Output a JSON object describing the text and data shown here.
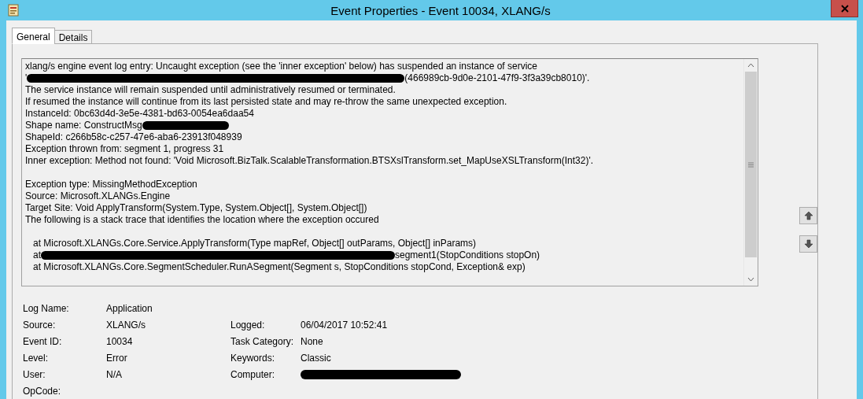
{
  "window": {
    "title": "Event Properties - Event 10034, XLANG/s"
  },
  "tabs": [
    {
      "label": "General",
      "selected": true
    },
    {
      "label": "Details",
      "selected": false
    }
  ],
  "message": {
    "lines": [
      {
        "parts": [
          {
            "kind": "text",
            "text": "xlang/s engine event log entry: Uncaught exception (see the 'inner exception' below) has suspended an instance of service"
          }
        ]
      },
      {
        "parts": [
          {
            "kind": "text",
            "text": "'"
          },
          {
            "kind": "redacted"
          },
          {
            "kind": "text",
            "text": "(466989cb-9d0e-2101-47f9-3f3a39cb8010)'."
          }
        ]
      },
      {
        "parts": [
          {
            "kind": "text",
            "text": "The service instance will remain suspended until administratively resumed or terminated."
          }
        ]
      },
      {
        "parts": [
          {
            "kind": "text",
            "text": "If resumed the instance will continue from its last persisted state and may re-throw the same unexpected exception."
          }
        ]
      },
      {
        "parts": [
          {
            "kind": "text",
            "text": "InstanceId: 0bc63d4d-3e5e-4381-bd63-0054ea6daa54"
          }
        ]
      },
      {
        "parts": [
          {
            "kind": "text",
            "text": "Shape name: ConstructMsg"
          },
          {
            "kind": "redacted"
          }
        ]
      },
      {
        "parts": [
          {
            "kind": "text",
            "text": "ShapeId: c266b58c-c257-47e6-aba6-23913f048939"
          }
        ]
      },
      {
        "parts": [
          {
            "kind": "text",
            "text": "Exception thrown from: segment 1, progress 31"
          }
        ]
      },
      {
        "parts": [
          {
            "kind": "text",
            "text": "Inner exception: Method not found: 'Void Microsoft.BizTalk.ScalableTransformation.BTSXslTransform.set_MapUseXSLTransform(Int32)'."
          }
        ]
      },
      {
        "gap_before": true,
        "parts": [
          {
            "kind": "text",
            "text": "Exception type: MissingMethodException"
          }
        ]
      },
      {
        "parts": [
          {
            "kind": "text",
            "text": "Source: Microsoft.XLANGs.Engine"
          }
        ]
      },
      {
        "parts": [
          {
            "kind": "text",
            "text": "Target Site: Void ApplyTransform(System.Type, System.Object[], System.Object[])"
          }
        ]
      },
      {
        "parts": [
          {
            "kind": "text",
            "text": "The following is a stack trace that identifies the location where the exception occured"
          }
        ]
      },
      {
        "gap_before": true,
        "parts": [
          {
            "kind": "text",
            "text": "   at Microsoft.XLANGs.Core.Service.ApplyTransform(Type mapRef, Object[] outParams, Object[] inParams)"
          }
        ]
      },
      {
        "parts": [
          {
            "kind": "text",
            "text": "   at"
          },
          {
            "kind": "redacted"
          },
          {
            "kind": "text",
            "text": "segment1(StopConditions stopOn)"
          }
        ]
      },
      {
        "parts": [
          {
            "kind": "text",
            "text": "   at Microsoft.XLANGs.Core.SegmentScheduler.RunASegment(Segment s, StopConditions stopCond, Exception& exp)"
          }
        ]
      }
    ]
  },
  "details": [
    {
      "left": {
        "label": "Log Name:",
        "value": "Application"
      }
    },
    {
      "left": {
        "label": "Source:",
        "value": "XLANG/s"
      },
      "right": {
        "label": "Logged:",
        "value": "06/04/2017 10:52:41"
      }
    },
    {
      "left": {
        "label": "Event ID:",
        "value": "10034"
      },
      "right": {
        "label": "Task Category:",
        "value": "None"
      }
    },
    {
      "left": {
        "label": "Level:",
        "value": "Error"
      },
      "right": {
        "label": "Keywords:",
        "value": "Classic"
      }
    },
    {
      "left": {
        "label": "User:",
        "value": "N/A"
      },
      "right": {
        "label": "Computer:",
        "redacted": true
      }
    },
    {
      "left": {
        "label": "OpCode:"
      }
    }
  ]
}
